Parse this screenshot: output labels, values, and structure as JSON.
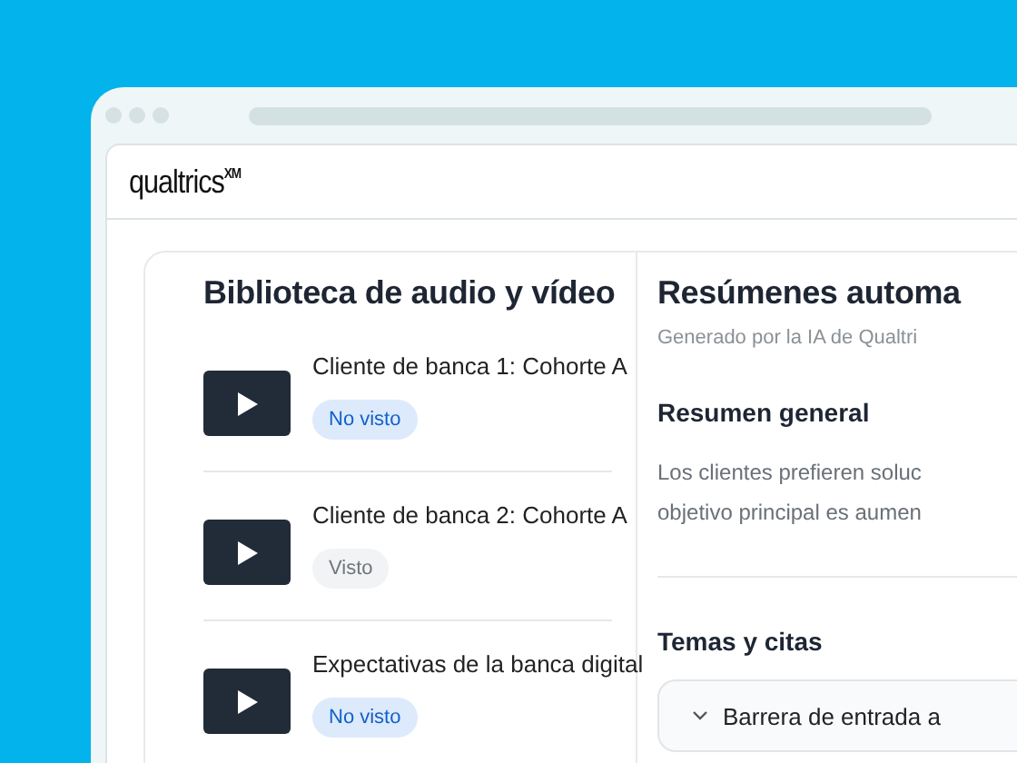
{
  "browser": {
    "logo": "qualtrics",
    "logo_mark": "XM"
  },
  "library": {
    "title": "Biblioteca de audio y vídeo",
    "items": [
      {
        "title": "Cliente de banca 1: Cohorte A",
        "status": "No visto",
        "watched": false
      },
      {
        "title": "Cliente de banca 2: Cohorte A",
        "status": "Visto",
        "watched": true
      },
      {
        "title": "Expectativas de la banca digital",
        "status": "No visto",
        "watched": false
      }
    ]
  },
  "summaries": {
    "title": "Resúmenes automa",
    "subtitle": "Generado por la IA de Qualtri",
    "overview_heading": "Resumen general",
    "overview_lines": [
      "Los clientes prefieren soluc",
      "objetivo principal es aumen"
    ],
    "themes_heading": "Temas y citas",
    "themes": [
      {
        "label": "Barrera de entrada a",
        "expanded": false
      }
    ]
  }
}
